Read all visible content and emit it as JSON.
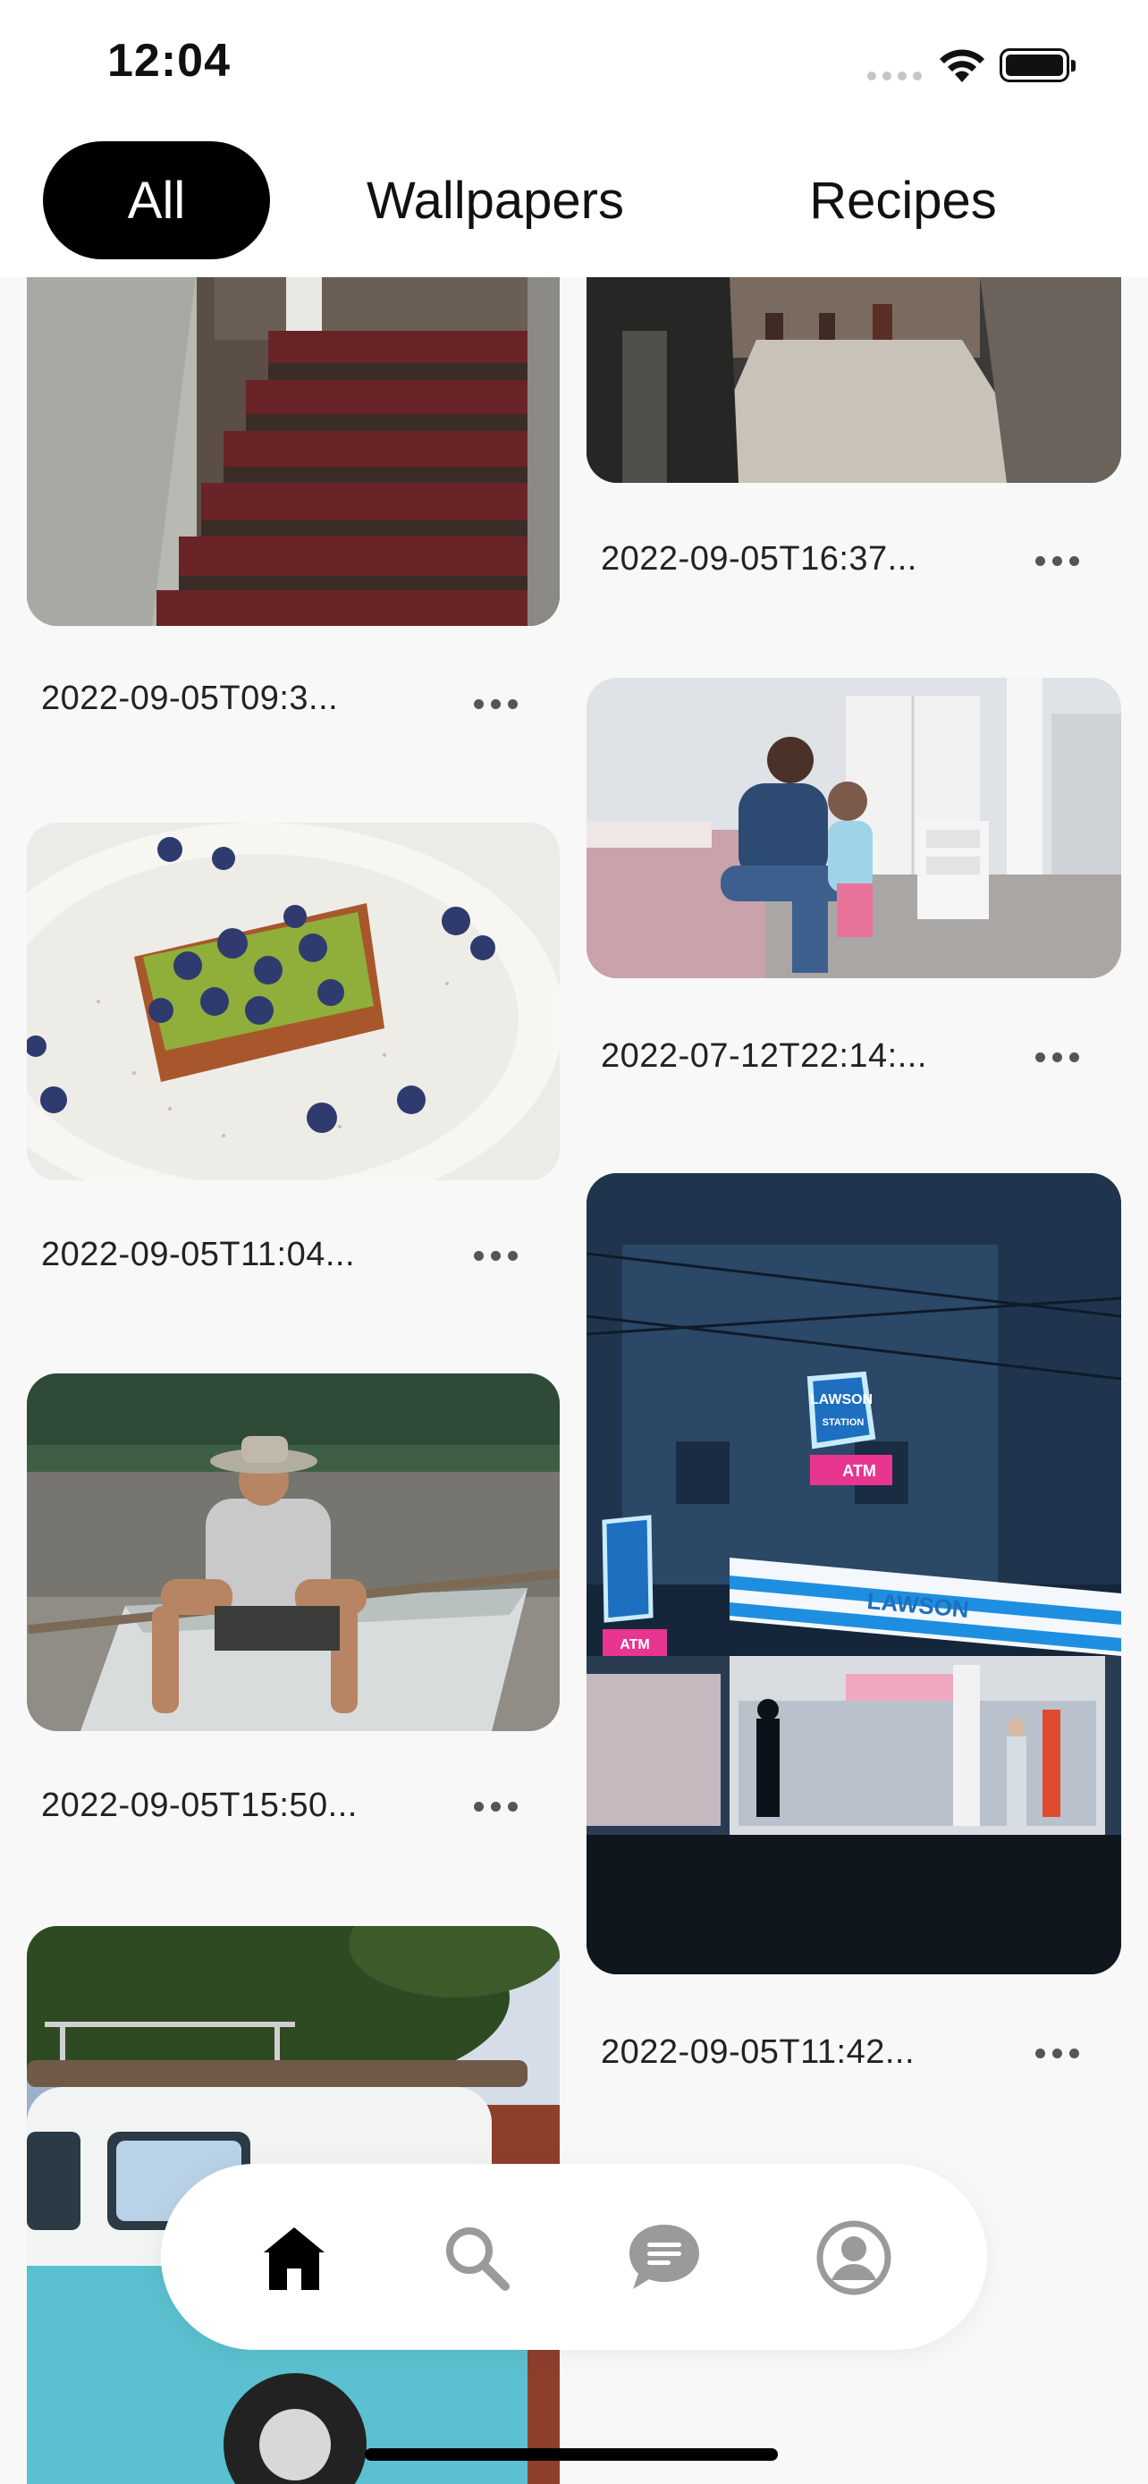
{
  "status_bar": {
    "time": "12:04"
  },
  "tabs": [
    {
      "label": "All",
      "active": true
    },
    {
      "label": "Wallpapers",
      "active": false
    },
    {
      "label": "Recipes",
      "active": false
    }
  ],
  "photos": [
    {
      "caption": "2022-09-05T09:3...",
      "subject": "red staircase"
    },
    {
      "caption": "2022-09-05T16:37...",
      "subject": "stone alley"
    },
    {
      "caption": "2022-07-12T22:14:...",
      "subject": "father and daughter in bedroom"
    },
    {
      "caption": "2022-09-05T11:04...",
      "subject": "avocado toast with blueberries"
    },
    {
      "caption": "2022-09-05T15:50...",
      "subject": "man sitting in rowboat"
    },
    {
      "caption": "2022-09-05T11:42...",
      "subject": "Lawson store at night",
      "sign_top": "LAWSON",
      "sign_sub": "STATION",
      "atm_label": "ATM",
      "store_name": "LAWSON"
    },
    {
      "caption": "",
      "subject": "light blue camper van"
    }
  ],
  "bottom_nav": [
    {
      "icon": "home-icon",
      "active": true
    },
    {
      "icon": "search-icon",
      "active": false
    },
    {
      "icon": "chat-icon",
      "active": false
    },
    {
      "icon": "profile-icon",
      "active": false
    }
  ],
  "colors": {
    "accent": "#000000",
    "nav_inactive": "#9a9a9a",
    "background": "#f8f8f8"
  }
}
